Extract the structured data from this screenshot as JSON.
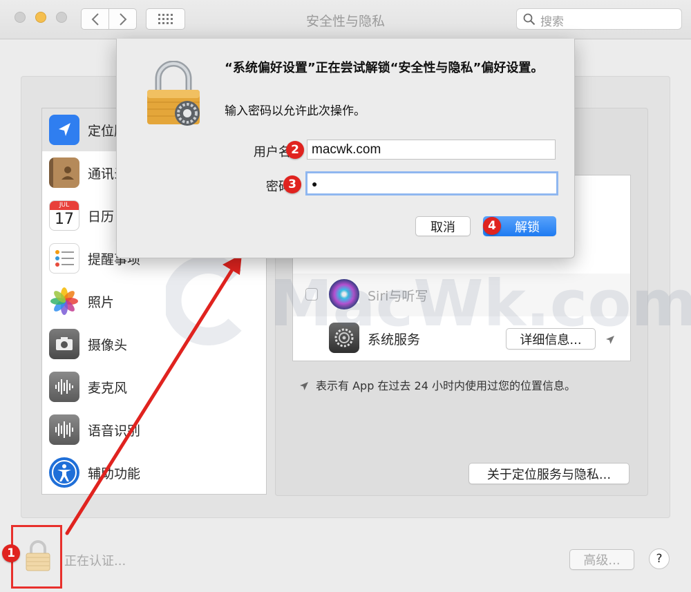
{
  "window": {
    "title": "安全性与隐私",
    "search_placeholder": "搜索"
  },
  "sidebar": {
    "items": [
      {
        "label": "定位服务",
        "icon": "location-arrow-icon",
        "selected": true
      },
      {
        "label": "通讯录",
        "icon": "contacts-book-icon"
      },
      {
        "label": "日历",
        "icon": "calendar-icon",
        "calendar_month": "JUL",
        "calendar_day": "17"
      },
      {
        "label": "提醒事项",
        "icon": "reminders-icon"
      },
      {
        "label": "照片",
        "icon": "photos-icon"
      },
      {
        "label": "摄像头",
        "icon": "camera-icon"
      },
      {
        "label": "麦克风",
        "icon": "microphone-icon"
      },
      {
        "label": "语音识别",
        "icon": "speech-recognition-icon"
      },
      {
        "label": "辅助功能",
        "icon": "accessibility-icon"
      }
    ]
  },
  "apps": {
    "siri_label": "Siri与听写",
    "system_services_label": "系统服务",
    "details_button": "详细信息..."
  },
  "location_note": "表示有 App 在过去 24 小时内使用过您的位置信息。",
  "about_button": "关于定位服务与隐私...",
  "bottom": {
    "status": "正在认证...",
    "advanced_button": "高级...",
    "help_button": "?"
  },
  "watermark": {
    "text": "MacWk.com"
  },
  "dialog": {
    "title": "“系统偏好设置”正在尝试解锁“安全性与隐私”偏好设置。",
    "description": "输入密码以允许此次操作。",
    "username_label": "用户名:",
    "username_value": "macwk.com",
    "password_label": "密码:",
    "password_value": "●",
    "cancel_button": "取消",
    "unlock_button": "解锁"
  },
  "annotations": {
    "step1": "1",
    "step2": "2",
    "step3": "3",
    "step4": "4"
  },
  "colors": {
    "accent_blue": "#1e7bf1",
    "annotation_red": "#e0231f"
  }
}
